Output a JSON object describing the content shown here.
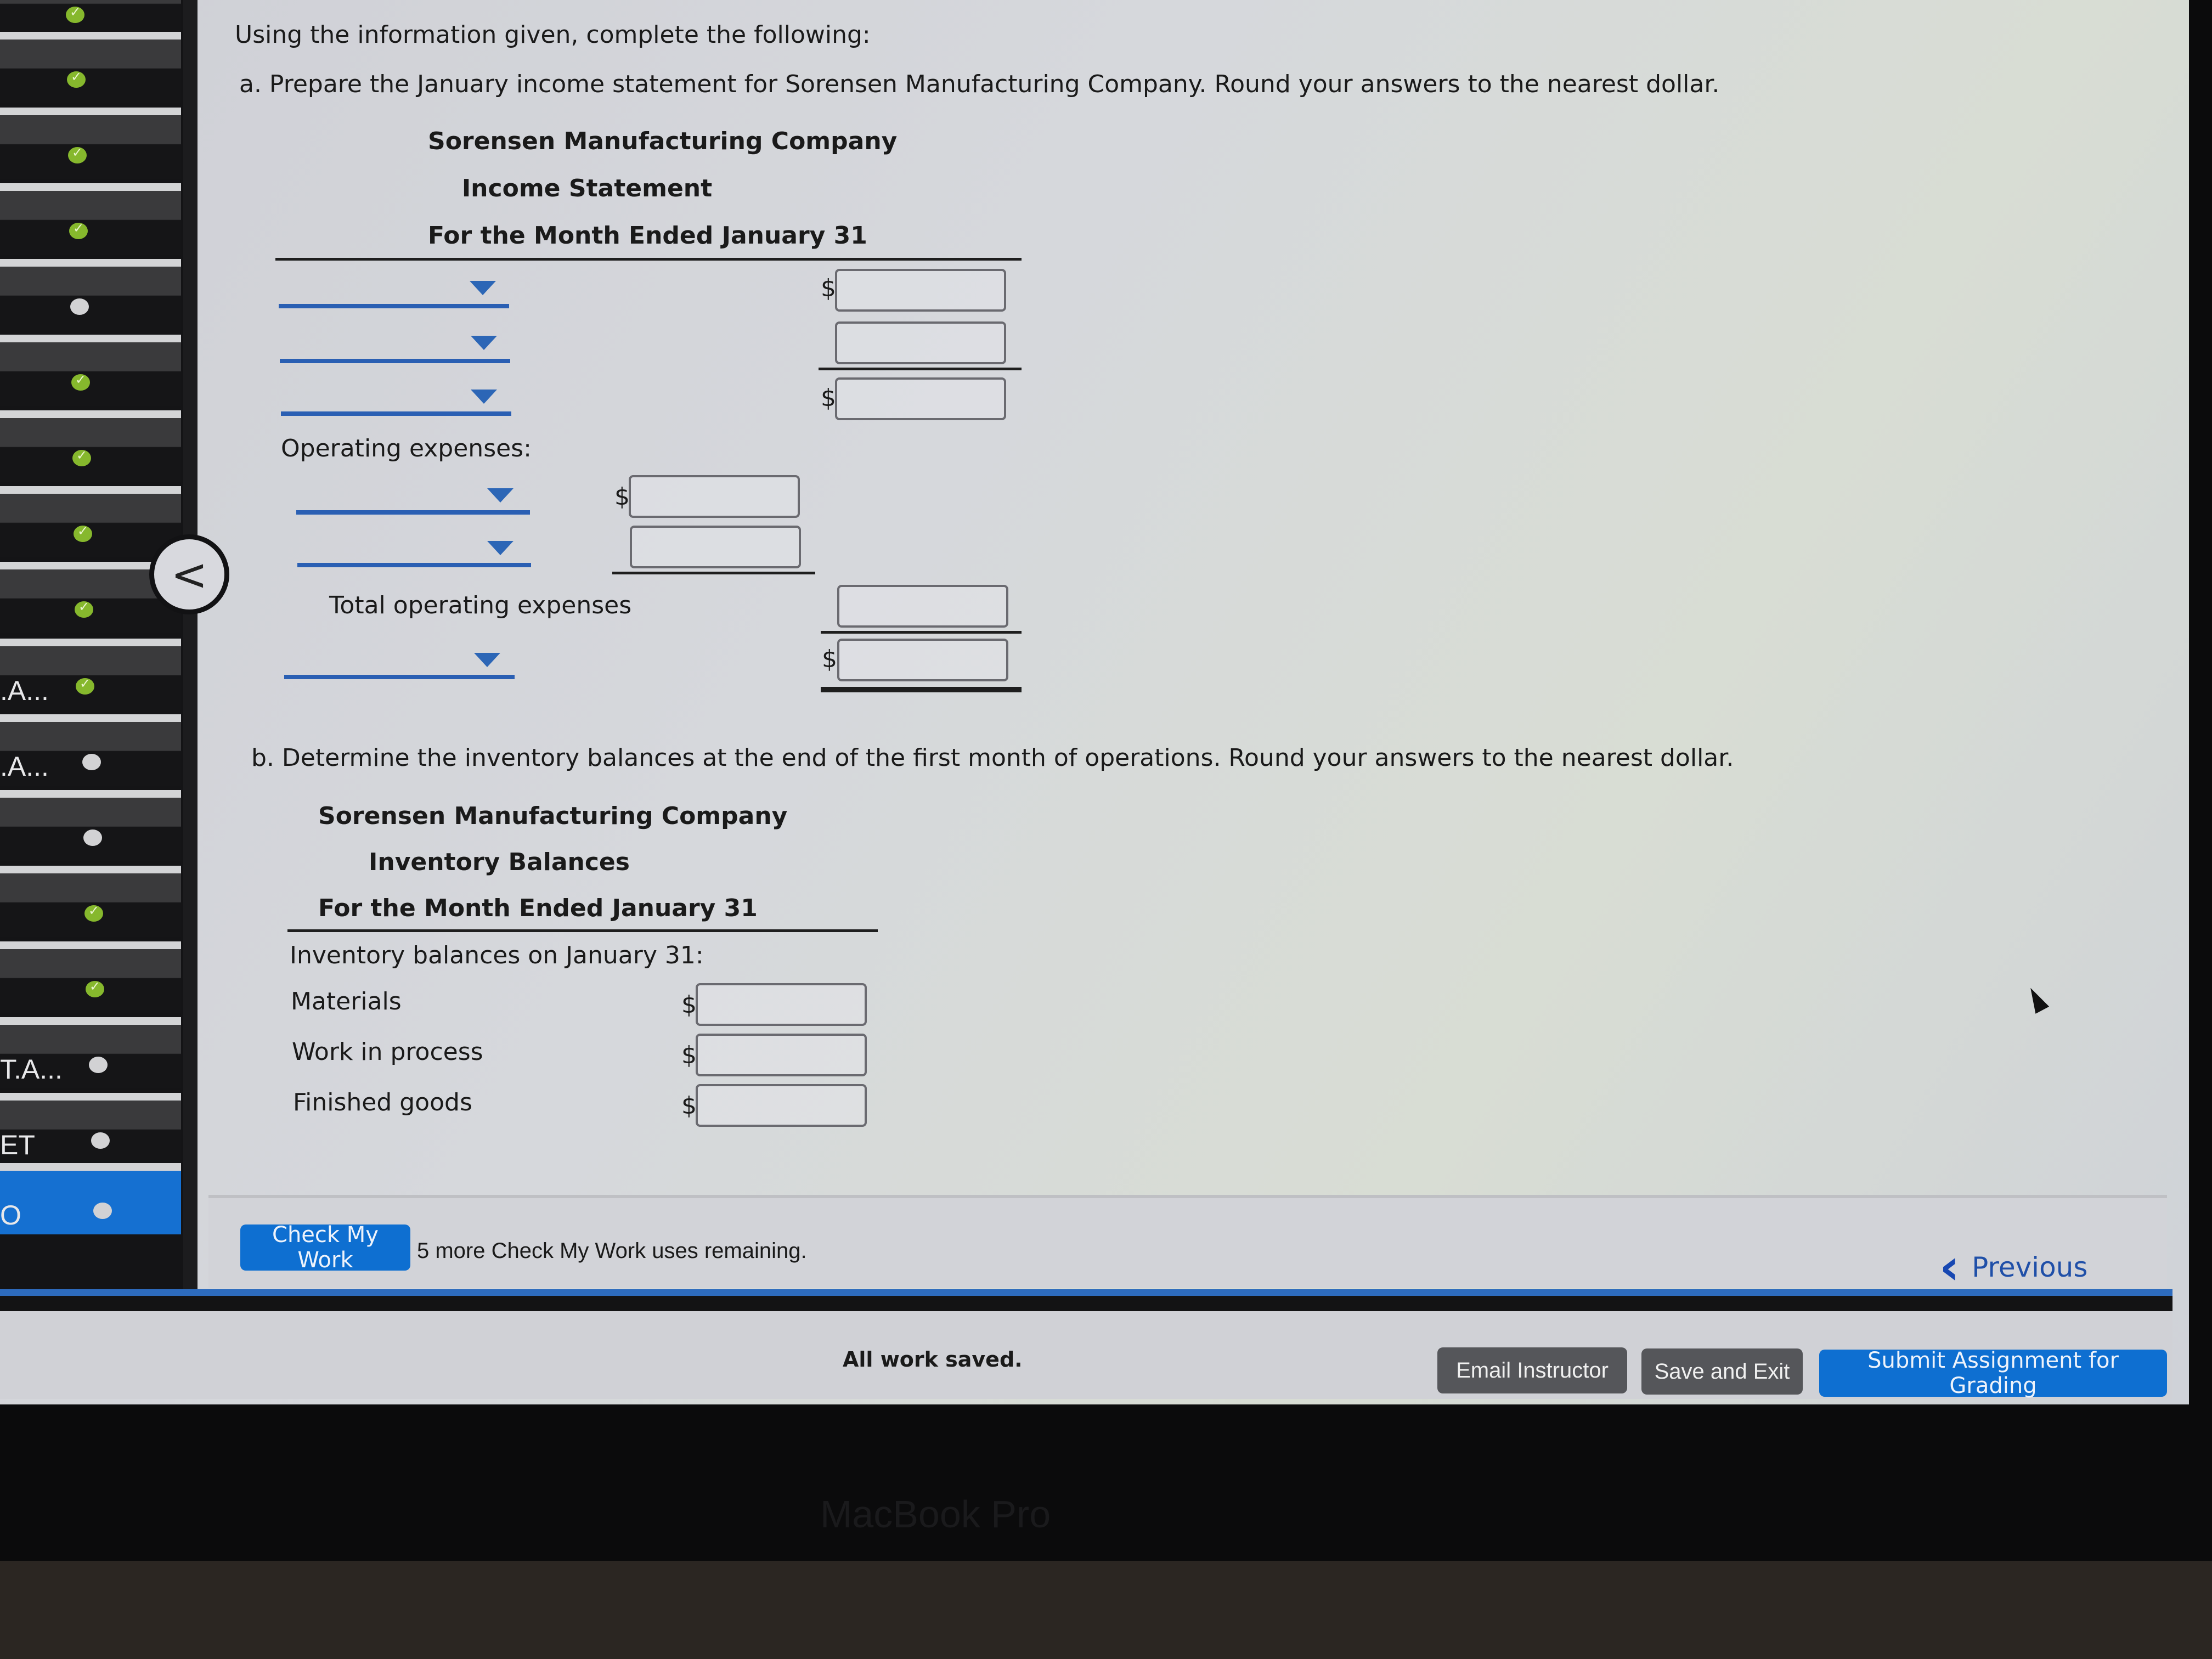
{
  "sidebar": {
    "items": [
      {
        "label": "",
        "status": "done"
      },
      {
        "label": "",
        "status": "done"
      },
      {
        "label": "",
        "status": "done"
      },
      {
        "label": "",
        "status": "todo"
      },
      {
        "label": "",
        "status": "done"
      },
      {
        "label": "",
        "status": "done"
      },
      {
        "label": "",
        "status": "done"
      },
      {
        "label": "",
        "status": "done"
      },
      {
        "label": "",
        "status": "done"
      },
      {
        "label": ".A...",
        "status": "todo"
      },
      {
        "label": "",
        "status": "todo"
      },
      {
        "label": "",
        "status": "done"
      },
      {
        "label": "",
        "status": "done"
      },
      {
        "label": "T.A...",
        "status": "todo"
      },
      {
        "label": "ET",
        "status": "todo"
      },
      {
        "label": "O",
        "status": "todo",
        "active": true
      }
    ],
    "collapse_icon": "chevron-left-icon"
  },
  "instructions": {
    "intro": "Using the information given, complete the following:",
    "part_a": "a. Prepare the January income statement for Sorensen Manufacturing Company. Round your answers to the nearest dollar.",
    "part_b": "b. Determine the inventory balances at the end of the first month of operations. Round your answers to the nearest dollar."
  },
  "income_statement": {
    "company": "Sorensen Manufacturing Company",
    "title": "Income Statement",
    "period": "For the Month Ended January 31",
    "currency_symbol": "$",
    "line_dropdowns": [
      "",
      "",
      ""
    ],
    "amounts": [
      "",
      "",
      ""
    ],
    "operating_expenses_label": "Operating expenses:",
    "operating_expense_dropdowns": [
      "",
      ""
    ],
    "operating_expense_amounts": [
      "",
      ""
    ],
    "total_operating_expenses_label": "Total operating expenses",
    "total_operating_expenses_amount": "",
    "final_dropdown": "",
    "final_amount": ""
  },
  "inventory_balances": {
    "company": "Sorensen Manufacturing Company",
    "title": "Inventory Balances",
    "period": "For the Month Ended January 31",
    "subheading": "Inventory balances on January 31:",
    "currency_symbol": "$",
    "rows": [
      {
        "label": "Materials",
        "value": ""
      },
      {
        "label": "Work in process",
        "value": ""
      },
      {
        "label": "Finished goods",
        "value": ""
      }
    ]
  },
  "actions": {
    "check_my_work": "Check My Work",
    "check_remaining": "5 more Check My Work uses remaining.",
    "previous": "Previous",
    "status": "All work saved.",
    "email_instructor": "Email Instructor",
    "save_and_exit": "Save and Exit",
    "submit": "Submit Assignment for Grading"
  },
  "device": {
    "bezel_label": "MacBook Pro"
  },
  "colors": {
    "accent_blue": "#0e6fd1",
    "dropdown_blue": "#2c66b6",
    "complete_green": "#86b82d",
    "dark_button": "#55565a"
  }
}
